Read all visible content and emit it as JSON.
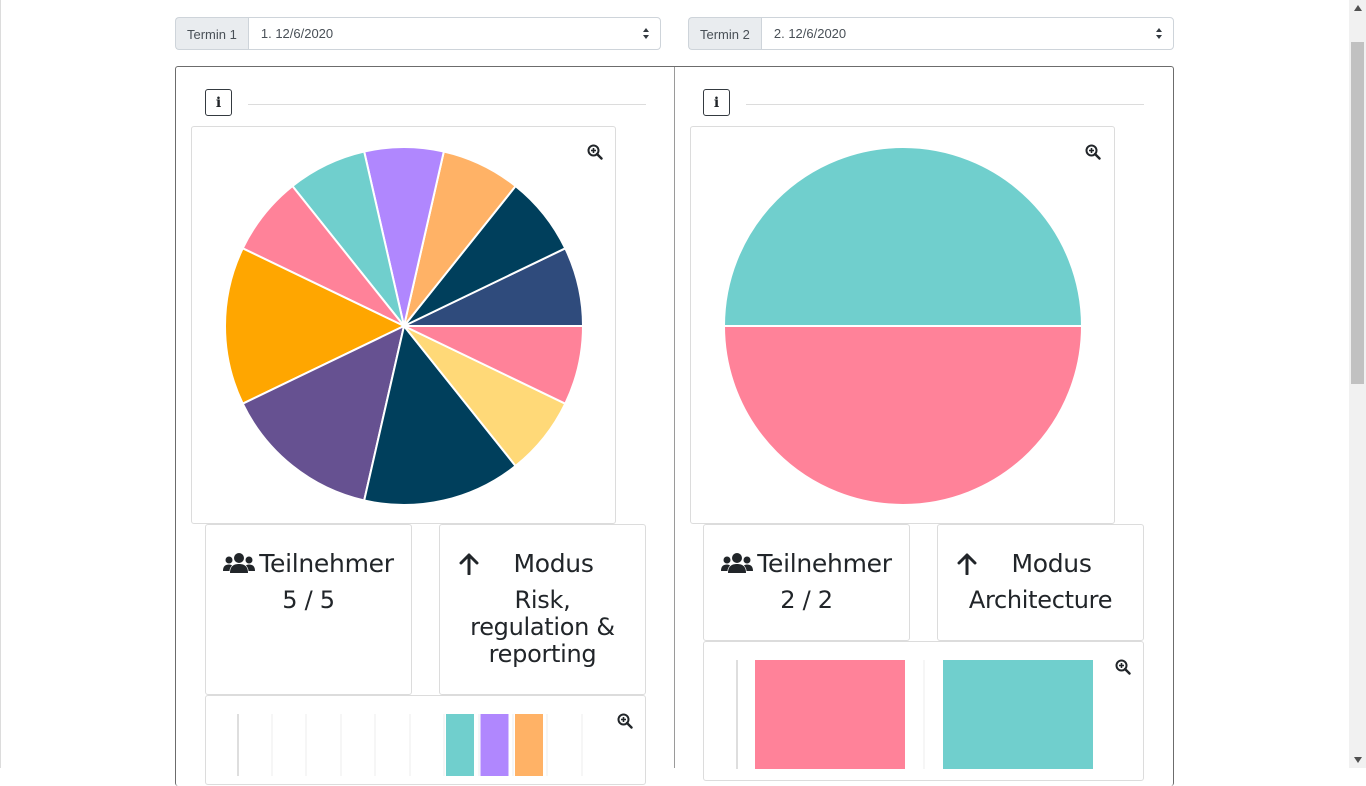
{
  "selectors": [
    {
      "label": "Termin 1",
      "value": "1. 12/6/2020"
    },
    {
      "label": "Termin 2",
      "value": "2. 12/6/2020"
    }
  ],
  "panels": [
    {
      "info_label": "i",
      "participants_label": "Teilnehmer",
      "participants_value": "5 / 5",
      "mode_label": "Modus",
      "mode_value_lines": [
        "Risk,",
        "regulation &",
        "reporting"
      ]
    },
    {
      "info_label": "i",
      "participants_label": "Teilnehmer",
      "participants_value": "2 / 2",
      "mode_label": "Modus",
      "mode_value_lines": [
        "Architecture"
      ]
    }
  ],
  "chart_data": [
    {
      "type": "pie",
      "values": [
        1,
        1,
        1,
        1,
        1,
        1,
        2,
        2,
        2,
        1,
        1
      ],
      "colors": [
        "#2f4b7c",
        "#003f5c",
        "#ffb266",
        "#b087fe",
        "#70cfcd",
        "#ff8299",
        "#ffa600",
        "#665191",
        "#003f5c",
        "#ffd978",
        "#ff8299"
      ]
    },
    {
      "type": "pie",
      "values": [
        1,
        1
      ],
      "colors": [
        "#70cfcd",
        "#ff8299"
      ]
    },
    {
      "type": "bar",
      "values": [
        1,
        1,
        1
      ],
      "colors": [
        "#70cfcd",
        "#b087fe",
        "#ffb266"
      ]
    },
    {
      "type": "bar",
      "values": [
        1,
        1
      ],
      "colors": [
        "#ff8299",
        "#70cfcd"
      ]
    }
  ]
}
